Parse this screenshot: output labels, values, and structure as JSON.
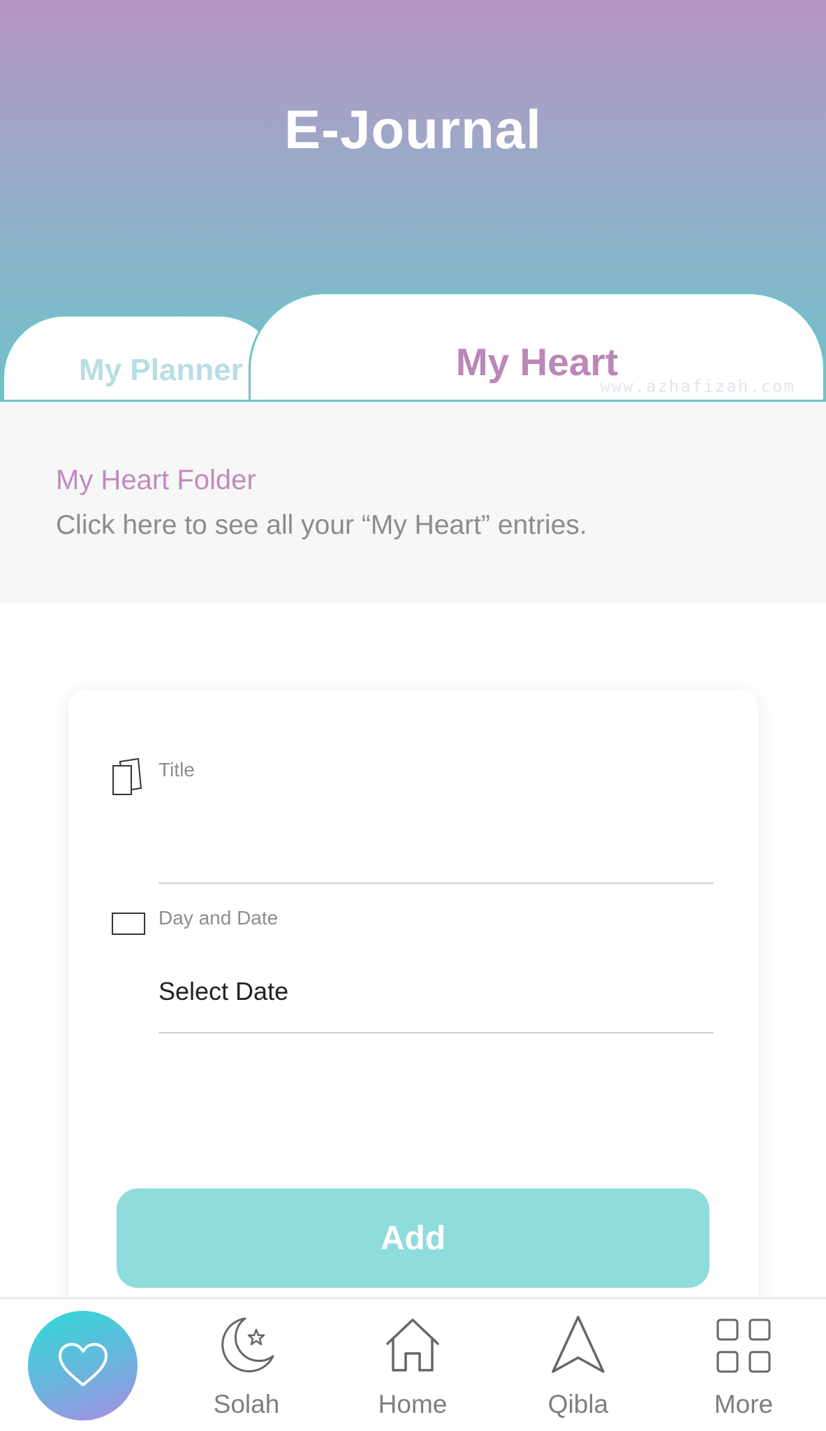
{
  "header": {
    "title": "E-Journal"
  },
  "tabs": [
    {
      "label": "My Planner",
      "active": false
    },
    {
      "label": "My Heart",
      "active": true
    }
  ],
  "watermark": "www.azhafizah.com",
  "folder": {
    "title": "My Heart Folder",
    "description": "Click here to see all your “My Heart” entries."
  },
  "form": {
    "title_label": "Title",
    "title_value": "",
    "date_label": "Day and Date",
    "date_value": "Select Date",
    "add_label": "Add"
  },
  "bottom_nav": {
    "items": [
      {
        "label": "",
        "icon": "heart-icon",
        "active": true
      },
      {
        "label": "Solah",
        "icon": "crescent-star-icon"
      },
      {
        "label": "Home",
        "icon": "home-icon"
      },
      {
        "label": "Qibla",
        "icon": "navigation-arrow-icon"
      },
      {
        "label": "More",
        "icon": "grid-icon"
      }
    ]
  },
  "colors": {
    "accent_teal": "#8edcdc",
    "accent_pink": "#bb86b8",
    "tab_border": "#6ec3c9"
  }
}
